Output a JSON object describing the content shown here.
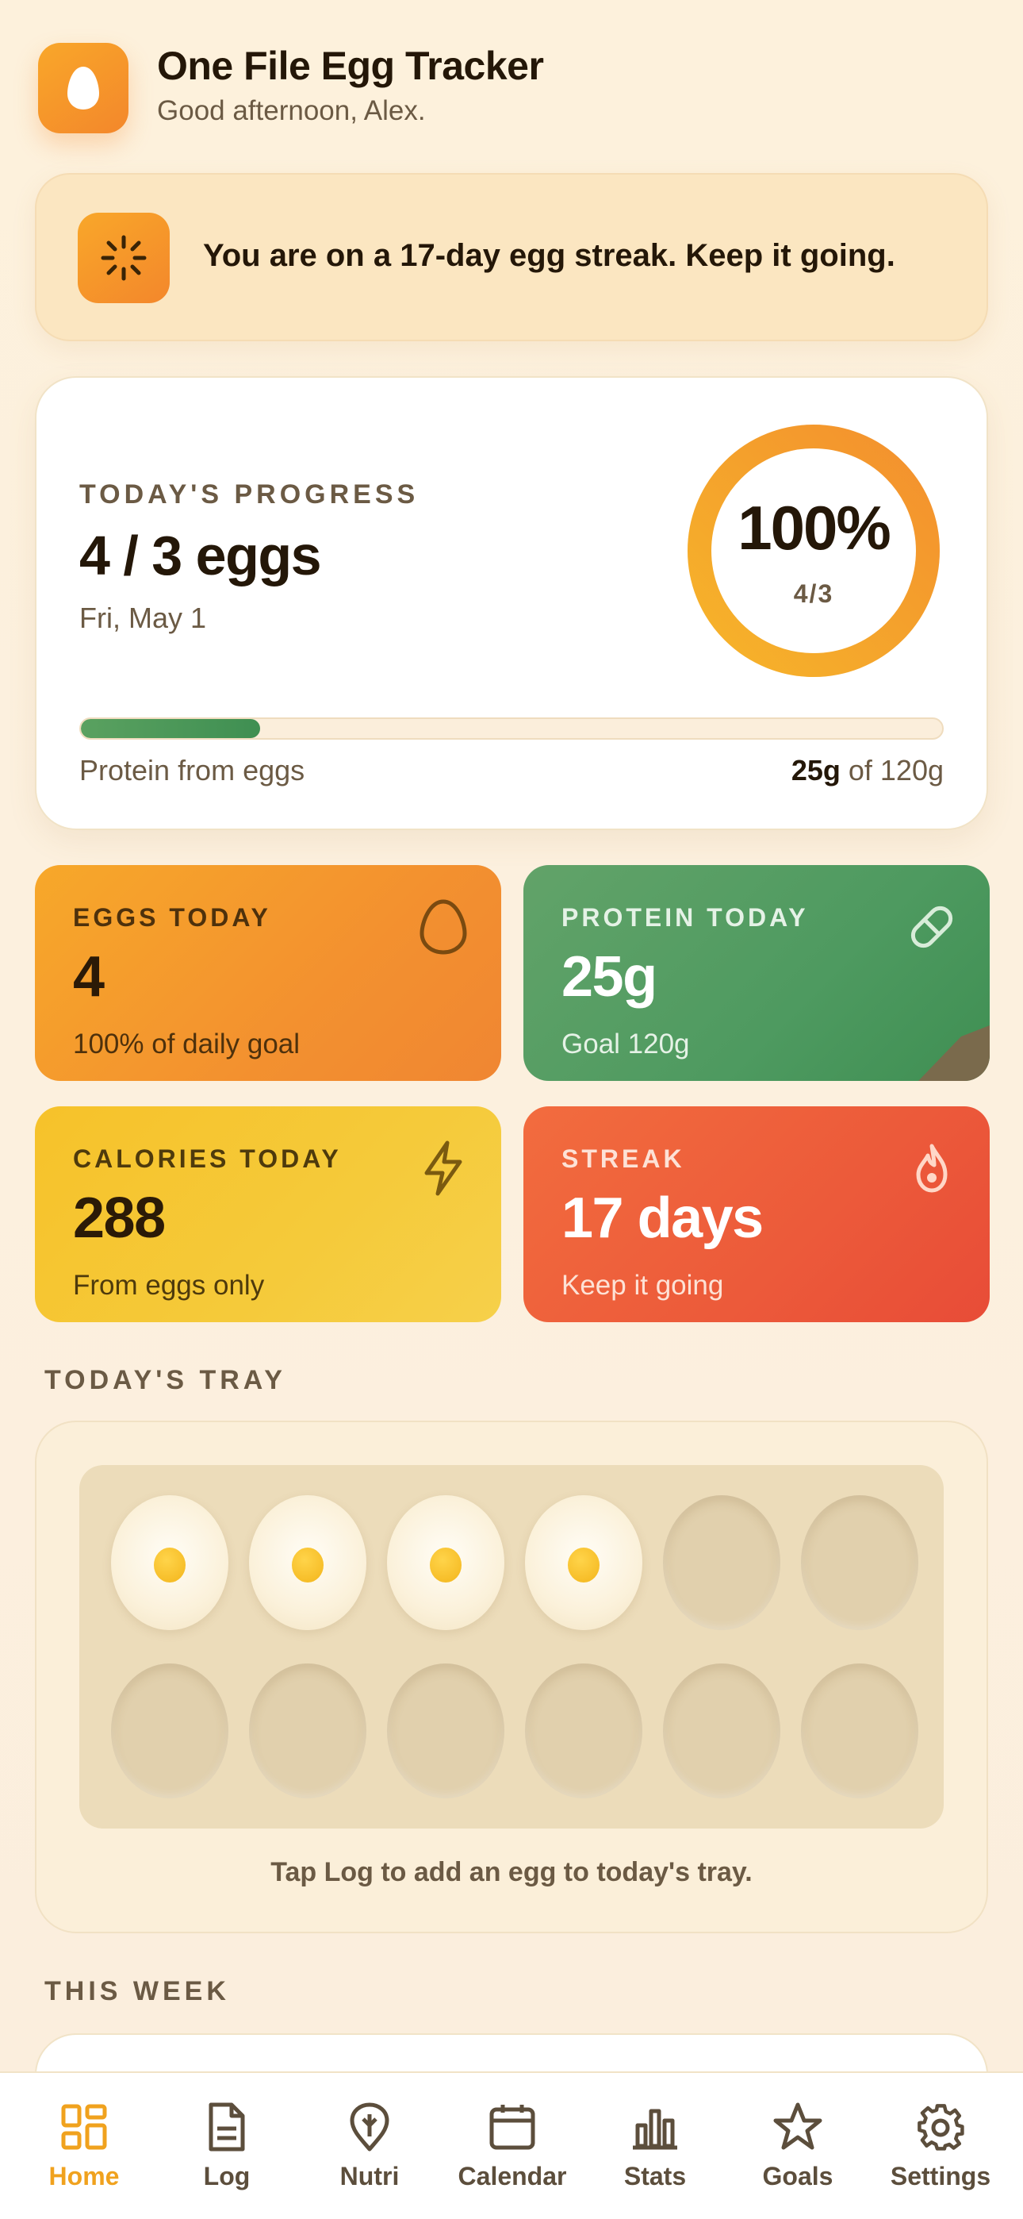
{
  "header": {
    "app_title": "One File Egg Tracker",
    "greeting": "Good afternoon, Alex.",
    "app_icon": "egg-icon"
  },
  "banner": {
    "text": "You are on a 17-day egg streak. Keep it going.",
    "icon": "sparkle-icon"
  },
  "progress": {
    "kicker": "TODAY'S PROGRESS",
    "value": "4 / 3 eggs",
    "date": "Fri, May 1",
    "ring_percent": "100%",
    "ring_fraction": "4/3",
    "ring_level": 1.0,
    "protein_label": "Protein from eggs",
    "protein_amount": "25g",
    "protein_of": "of 120g",
    "protein_fraction": 0.208
  },
  "tiles": {
    "eggs": {
      "kicker": "EGGS TODAY",
      "value": "4",
      "sub": "100% of daily goal",
      "icon": "egg-outline-icon"
    },
    "protein": {
      "kicker": "PROTEIN TODAY",
      "value": "25g",
      "sub": "Goal 120g",
      "icon": "pill-icon"
    },
    "calories": {
      "kicker": "CALORIES TODAY",
      "value": "288",
      "sub": "From eggs only",
      "icon": "lightning-icon"
    },
    "streak": {
      "kicker": "STREAK",
      "value": "17 days",
      "sub": "Keep it going",
      "icon": "flame-icon"
    }
  },
  "tray": {
    "kicker": "TODAY'S TRAY",
    "slots_total": 12,
    "eggs_filled": 4,
    "hint": "Tap Log to add an egg to today's tray."
  },
  "week": {
    "kicker": "THIS WEEK"
  },
  "tabs": [
    {
      "label": "Home",
      "icon": "home-grid-icon",
      "active": true
    },
    {
      "label": "Log",
      "icon": "document-icon",
      "active": false
    },
    {
      "label": "Nutri",
      "icon": "leaf-pin-icon",
      "active": false
    },
    {
      "label": "Calendar",
      "icon": "calendar-icon",
      "active": false
    },
    {
      "label": "Stats",
      "icon": "bar-chart-icon",
      "active": false
    },
    {
      "label": "Goals",
      "icon": "star-icon",
      "active": false
    },
    {
      "label": "Settings",
      "icon": "gear-icon",
      "active": false
    }
  ],
  "colors": {
    "accent": "#f0a21e",
    "protein_green": "#4e9a60",
    "streak_red": "#ec5a3a",
    "calorie_yellow": "#f5ca3a"
  }
}
